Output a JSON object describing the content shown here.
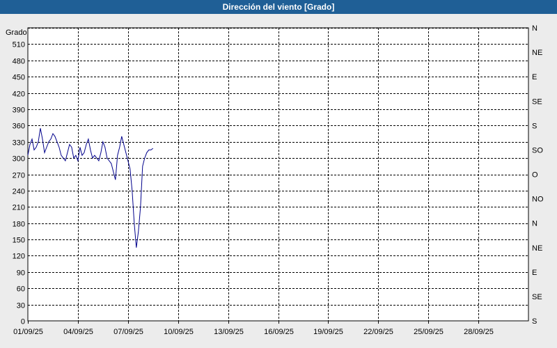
{
  "window": {
    "title": "Dirección del viento [Grado]"
  },
  "colors": {
    "titlebar": "#1f5f96",
    "background": "#ececec",
    "plot_area": "#ffffff",
    "series": "#00008b",
    "grid": "#000000"
  },
  "chart_data": {
    "type": "line",
    "title": "Dirección del viento [Grado]",
    "ylabel": "Grado",
    "xlabel": "",
    "ylim": [
      0,
      540
    ],
    "xlim": [
      "01/09/25",
      "01/10/25"
    ],
    "grid": true,
    "y_ticks": [
      0,
      30,
      60,
      90,
      120,
      150,
      180,
      210,
      240,
      270,
      300,
      330,
      360,
      390,
      420,
      450,
      480,
      510
    ],
    "x_ticks": [
      "01/09/25",
      "04/09/25",
      "07/09/25",
      "10/09/25",
      "13/09/25",
      "16/09/25",
      "19/09/25",
      "22/09/25",
      "25/09/25",
      "28/09/25"
    ],
    "right_axis_labels": [
      "S",
      "SE",
      "E",
      "NE",
      "N",
      "NO",
      "O",
      "SO",
      "S",
      "SE",
      "E",
      "NE",
      "N"
    ],
    "series": [
      {
        "name": "",
        "x": [
          "2025-09-01 00:00",
          "2025-09-01 03:00",
          "2025-09-01 06:00",
          "2025-09-01 09:00",
          "2025-09-01 12:00",
          "2025-09-01 15:00",
          "2025-09-01 18:00",
          "2025-09-01 21:00",
          "2025-09-02 00:00",
          "2025-09-02 03:00",
          "2025-09-02 06:00",
          "2025-09-02 09:00",
          "2025-09-02 12:00",
          "2025-09-02 15:00",
          "2025-09-02 18:00",
          "2025-09-02 21:00",
          "2025-09-03 00:00",
          "2025-09-03 03:00",
          "2025-09-03 06:00",
          "2025-09-03 09:00",
          "2025-09-03 12:00",
          "2025-09-03 15:00",
          "2025-09-03 18:00",
          "2025-09-03 21:00",
          "2025-09-04 00:00",
          "2025-09-04 03:00",
          "2025-09-04 06:00",
          "2025-09-04 09:00",
          "2025-09-04 12:00",
          "2025-09-04 15:00",
          "2025-09-04 18:00",
          "2025-09-04 21:00",
          "2025-09-05 00:00",
          "2025-09-05 03:00",
          "2025-09-05 06:00",
          "2025-09-05 09:00",
          "2025-09-05 12:00",
          "2025-09-05 15:00",
          "2025-09-05 18:00",
          "2025-09-05 21:00",
          "2025-09-06 00:00",
          "2025-09-06 03:00",
          "2025-09-06 06:00",
          "2025-09-06 09:00",
          "2025-09-06 12:00",
          "2025-09-06 15:00",
          "2025-09-06 18:00",
          "2025-09-06 21:00",
          "2025-09-07 00:00",
          "2025-09-07 03:00",
          "2025-09-07 06:00",
          "2025-09-07 09:00",
          "2025-09-07 12:00",
          "2025-09-07 15:00",
          "2025-09-07 18:00",
          "2025-09-07 21:00",
          "2025-09-08 00:00",
          "2025-09-08 03:00",
          "2025-09-08 06:00",
          "2025-09-08 09:00",
          "2025-09-08 12:00"
        ],
        "values": [
          305,
          325,
          335,
          315,
          320,
          330,
          355,
          335,
          310,
          320,
          330,
          335,
          345,
          340,
          330,
          320,
          305,
          300,
          295,
          310,
          325,
          320,
          300,
          305,
          295,
          320,
          305,
          310,
          325,
          335,
          315,
          300,
          305,
          300,
          295,
          310,
          330,
          320,
          300,
          295,
          290,
          275,
          260,
          305,
          320,
          340,
          325,
          310,
          295,
          280,
          240,
          180,
          135,
          165,
          210,
          285,
          300,
          310,
          315,
          315,
          318
        ]
      }
    ]
  }
}
